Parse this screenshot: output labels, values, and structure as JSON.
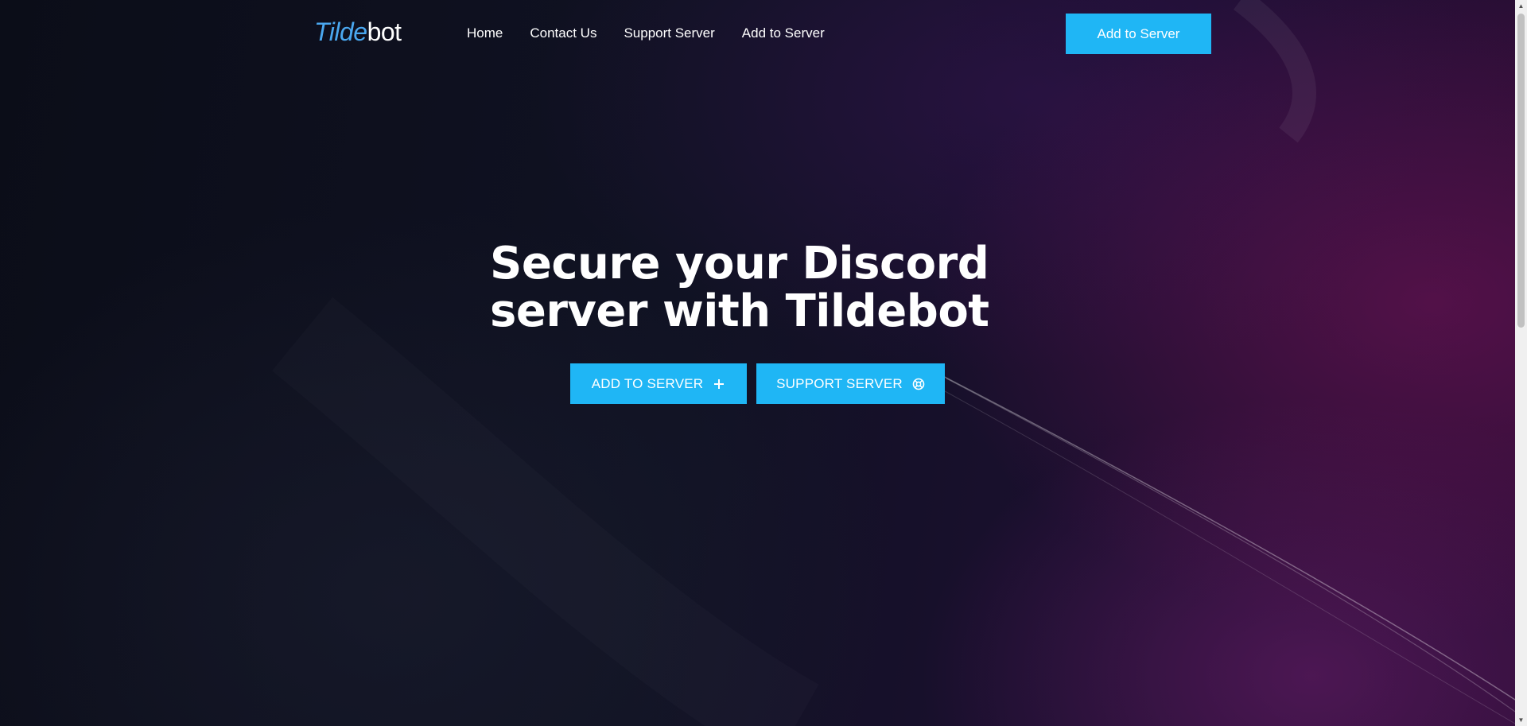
{
  "brand": {
    "logo_accent": "Tilde",
    "logo_rest": "bot",
    "accent_color": "#4aa8f0"
  },
  "nav": {
    "links": [
      "Home",
      "Contact Us",
      "Support Server",
      "Add to Server"
    ],
    "cta_label": "Add to Server"
  },
  "hero": {
    "title": "Secure your Discord server with Tildebot",
    "buttons": {
      "add_label": "ADD TO SERVER",
      "add_icon": "plus-icon",
      "support_label": "SUPPORT SERVER",
      "support_icon": "lifebuoy-icon"
    }
  },
  "colors": {
    "button_blue": "#1fb6f5",
    "background_dark": "#0d0f1a",
    "background_purple": "#2a0d35"
  }
}
